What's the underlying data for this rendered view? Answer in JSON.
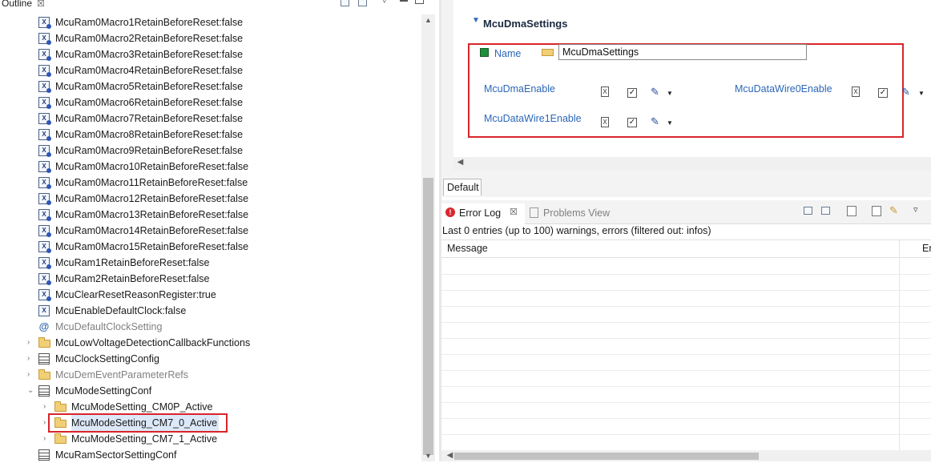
{
  "outline": {
    "tab_label": "Outline",
    "tab_close": "☒",
    "items": [
      {
        "label": "McuRam0Macro1RetainBeforeReset:false",
        "icon": "xb-param-icon",
        "indent": 1,
        "muted": false
      },
      {
        "label": "McuRam0Macro2RetainBeforeReset:false",
        "icon": "xb-param-icon",
        "indent": 1,
        "muted": false
      },
      {
        "label": "McuRam0Macro3RetainBeforeReset:false",
        "icon": "xb-param-icon",
        "indent": 1,
        "muted": false
      },
      {
        "label": "McuRam0Macro4RetainBeforeReset:false",
        "icon": "xb-param-icon",
        "indent": 1,
        "muted": false
      },
      {
        "label": "McuRam0Macro5RetainBeforeReset:false",
        "icon": "xb-param-icon",
        "indent": 1,
        "muted": false
      },
      {
        "label": "McuRam0Macro6RetainBeforeReset:false",
        "icon": "xb-param-icon",
        "indent": 1,
        "muted": false
      },
      {
        "label": "McuRam0Macro7RetainBeforeReset:false",
        "icon": "xb-param-icon",
        "indent": 1,
        "muted": false
      },
      {
        "label": "McuRam0Macro8RetainBeforeReset:false",
        "icon": "xb-param-icon",
        "indent": 1,
        "muted": false
      },
      {
        "label": "McuRam0Macro9RetainBeforeReset:false",
        "icon": "xb-param-icon",
        "indent": 1,
        "muted": false
      },
      {
        "label": "McuRam0Macro10RetainBeforeReset:false",
        "icon": "xb-param-icon",
        "indent": 1,
        "muted": false
      },
      {
        "label": "McuRam0Macro11RetainBeforeReset:false",
        "icon": "xb-param-icon",
        "indent": 1,
        "muted": false
      },
      {
        "label": "McuRam0Macro12RetainBeforeReset:false",
        "icon": "xb-param-icon",
        "indent": 1,
        "muted": false
      },
      {
        "label": "McuRam0Macro13RetainBeforeReset:false",
        "icon": "xb-param-icon",
        "indent": 1,
        "muted": false
      },
      {
        "label": "McuRam0Macro14RetainBeforeReset:false",
        "icon": "xb-param-icon",
        "indent": 1,
        "muted": false
      },
      {
        "label": "McuRam0Macro15RetainBeforeReset:false",
        "icon": "xb-param-icon",
        "indent": 1,
        "muted": false
      },
      {
        "label": "McuRam1RetainBeforeReset:false",
        "icon": "xb-param-icon",
        "indent": 1,
        "muted": false
      },
      {
        "label": "McuRam2RetainBeforeReset:false",
        "icon": "xb-param-icon",
        "indent": 1,
        "muted": false
      },
      {
        "label": "McuClearResetReasonRegister:true",
        "icon": "xb-param-icon",
        "indent": 1,
        "muted": false
      },
      {
        "label": "McuEnableDefaultClock:false",
        "icon": "x-param-icon",
        "indent": 1,
        "muted": false
      },
      {
        "label": "McuDefaultClockSetting",
        "icon": "reference-icon",
        "indent": 1,
        "muted": true
      },
      {
        "label": "McuLowVoltageDetectionCallbackFunctions",
        "icon": "folder-icon",
        "indent": 1,
        "muted": false,
        "expander": "›"
      },
      {
        "label": "McuClockSettingConfig",
        "icon": "table-icon",
        "indent": 1,
        "muted": false,
        "expander": "›"
      },
      {
        "label": "McuDemEventParameterRefs",
        "icon": "folder-icon",
        "indent": 1,
        "muted": true,
        "expander": "›"
      },
      {
        "label": "McuModeSettingConf",
        "icon": "table-icon",
        "indent": 1,
        "muted": false,
        "expander": "⌄"
      },
      {
        "label": "McuModeSetting_CM0P_Active",
        "icon": "folder-icon",
        "indent": 2,
        "muted": false,
        "expander": "›"
      },
      {
        "label": "McuModeSetting_CM7_0_Active",
        "icon": "folder-icon",
        "indent": 2,
        "muted": false,
        "expander": "›",
        "selected": true
      },
      {
        "label": "McuModeSetting_CM7_1_Active",
        "icon": "folder-icon",
        "indent": 2,
        "muted": false,
        "expander": "›"
      },
      {
        "label": "McuRamSectorSettingConf",
        "icon": "table-icon",
        "indent": 1,
        "muted": false
      }
    ]
  },
  "editor": {
    "section_title": "McuDmaSettings",
    "name_label": "Name",
    "name_value": "McuDmaSettings",
    "params": [
      {
        "label": "McuDmaEnable",
        "checked": true
      },
      {
        "label": "McuDataWire0Enable",
        "checked": true
      },
      {
        "label": "McuDataWire1Enable",
        "checked": true
      }
    ],
    "bottom_tab": "Default"
  },
  "error_log": {
    "tabs": [
      {
        "label": "Error Log",
        "active": true
      },
      {
        "label": "Problems View",
        "active": false
      }
    ],
    "status": "Last 0 entries (up to 100) warnings, errors (filtered out: infos)",
    "columns": [
      "Message",
      "Er"
    ]
  },
  "colors": {
    "highlight_box": "#d8252a",
    "link": "#2b67b8",
    "selection": "#dce8f7"
  }
}
